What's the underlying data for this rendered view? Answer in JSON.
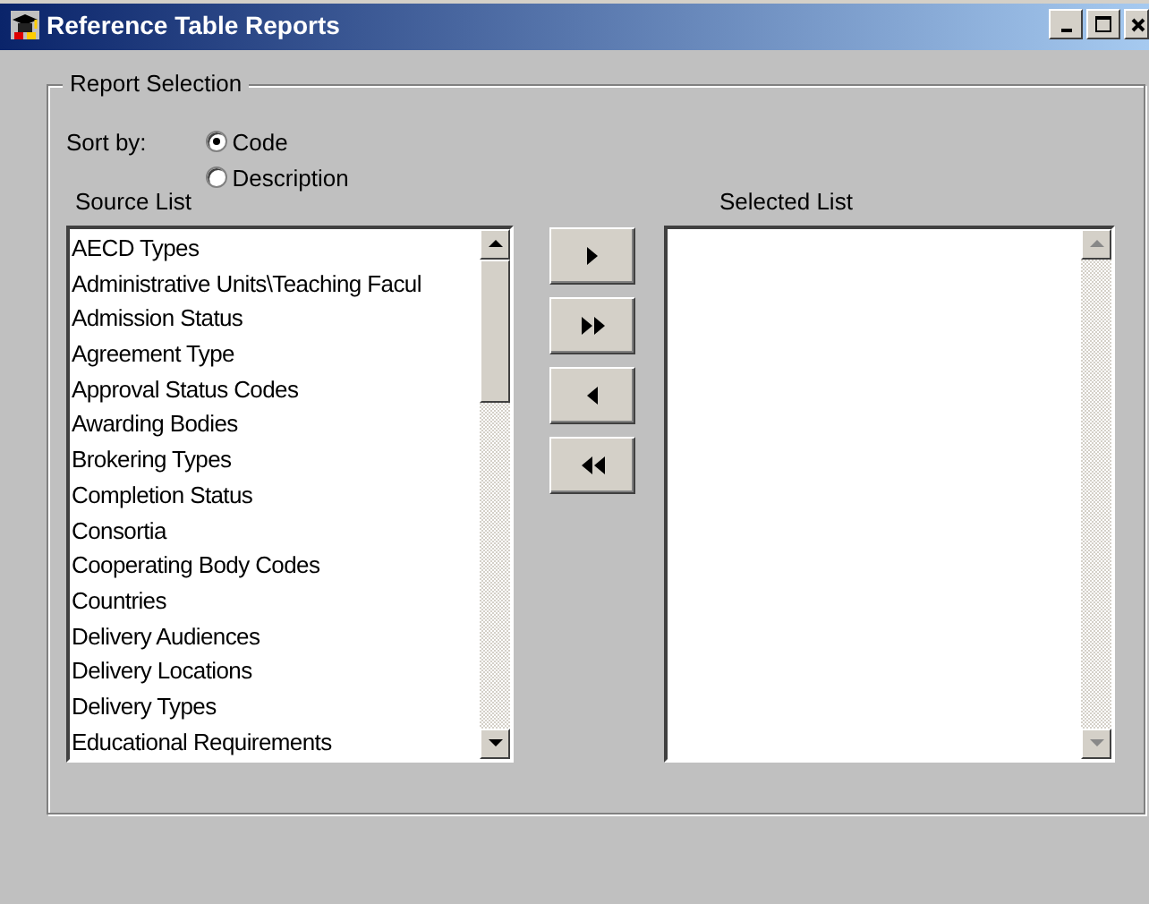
{
  "window": {
    "title": "Reference Table Reports"
  },
  "group": {
    "title": "Report Selection"
  },
  "sort": {
    "label": "Sort by:",
    "options": [
      {
        "label": "Code",
        "selected": true
      },
      {
        "label": "Description",
        "selected": false
      }
    ]
  },
  "source_list": {
    "label": "Source List",
    "items": [
      "AECD Types",
      "Administrative Units\\Teaching Facul",
      "Admission Status",
      "Agreement Type",
      "Approval Status Codes",
      "Awarding Bodies",
      "Brokering Types",
      "Completion Status",
      "Consortia",
      "Cooperating Body Codes",
      "Countries",
      "Delivery Audiences",
      "Delivery Locations",
      "Delivery Types",
      "Educational Requirements"
    ]
  },
  "move_buttons": [
    {
      "kind": "add"
    },
    {
      "kind": "add_all"
    },
    {
      "kind": "remove"
    },
    {
      "kind": "remove_all"
    }
  ],
  "selected_list": {
    "label": "Selected List"
  }
}
